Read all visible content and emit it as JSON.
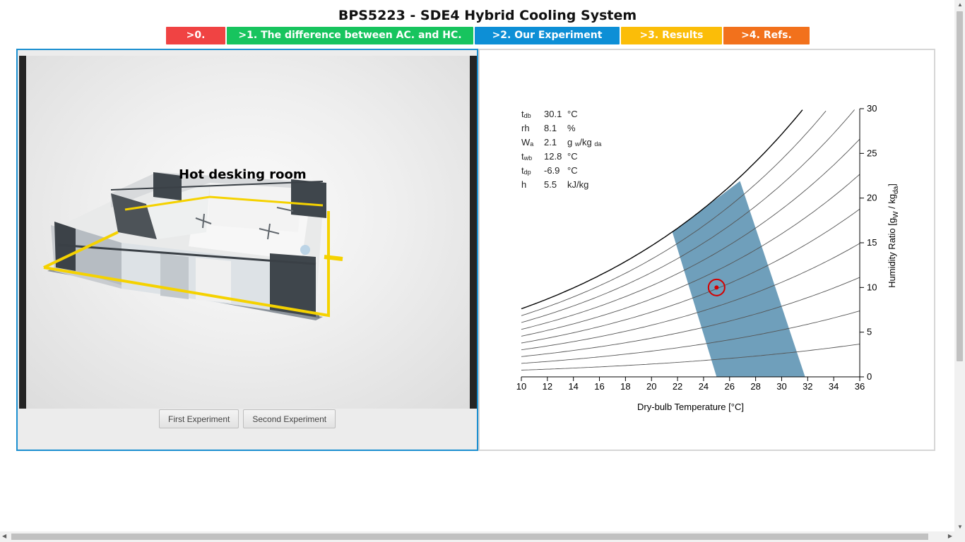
{
  "page": {
    "title": "BPS5223 - SDE4 Hybrid Cooling System"
  },
  "nav": {
    "tabs": [
      {
        "label": ">0.",
        "color": "#f04343"
      },
      {
        "label": ">1. The difference between AC. and HC.",
        "color": "#17c45e"
      },
      {
        "label": ">2. Our Experiment",
        "color": "#0d8fd6"
      },
      {
        "label": ">3. Results",
        "color": "#fbbd08"
      },
      {
        "label": ">4. Refs.",
        "color": "#f2711c"
      }
    ]
  },
  "viewer": {
    "room_label": "Hot desking room",
    "buttons": {
      "first": "First Experiment",
      "second": "Second Experiment"
    }
  },
  "readout": {
    "tdb": {
      "sym": "t",
      "sub": "db",
      "value": "30.1",
      "unit": "°C"
    },
    "rh": {
      "sym": "rh",
      "value": "8.1",
      "unit": "%"
    },
    "wa": {
      "sym": "W",
      "sub": "a",
      "value": "2.1",
      "unit_main": "g",
      "unit_sub1": "w",
      "unit_mid": "/kg",
      "unit_sub2": "da"
    },
    "twb": {
      "sym": "t",
      "sub": "wb",
      "value": "12.8",
      "unit": "°C"
    },
    "tdp": {
      "sym": "t",
      "sub": "dp",
      "value": "-6.9",
      "unit": "°C"
    },
    "h": {
      "sym": "h",
      "value": "5.5",
      "unit": "kJ/kg"
    }
  },
  "chart_data": {
    "type": "psychrometric",
    "xlabel": "Dry-bulb Temperature [°C]",
    "ylabel": "Humidity Ratio [g_W / kg_da]",
    "ylabel_parts": {
      "main": "Humidity Ratio [g",
      "sub1": "W",
      "mid": " / kg",
      "sub2": "da",
      "end": "]"
    },
    "xlim": [
      10,
      36
    ],
    "ylim": [
      0,
      30
    ],
    "x_ticks": [
      10,
      12,
      14,
      16,
      18,
      20,
      22,
      24,
      26,
      28,
      30,
      32,
      34,
      36
    ],
    "y_ticks": [
      0,
      5,
      10,
      15,
      20,
      25,
      30
    ],
    "rh_curves": [
      0.1,
      0.2,
      0.3,
      0.4,
      0.5,
      0.6,
      0.7,
      0.8,
      0.9,
      1.0
    ],
    "comfort_zone_color": "#6f9fbb",
    "comfort_zone": [
      {
        "x": 25.0,
        "y": 0
      },
      {
        "x": 31.8,
        "y": 0
      },
      {
        "x": 26.8,
        "y": 21.9
      },
      {
        "x": 21.6,
        "y": 16.2
      }
    ],
    "current_point": {
      "x": 25.0,
      "y": 10.0,
      "color": "#d40000"
    }
  }
}
